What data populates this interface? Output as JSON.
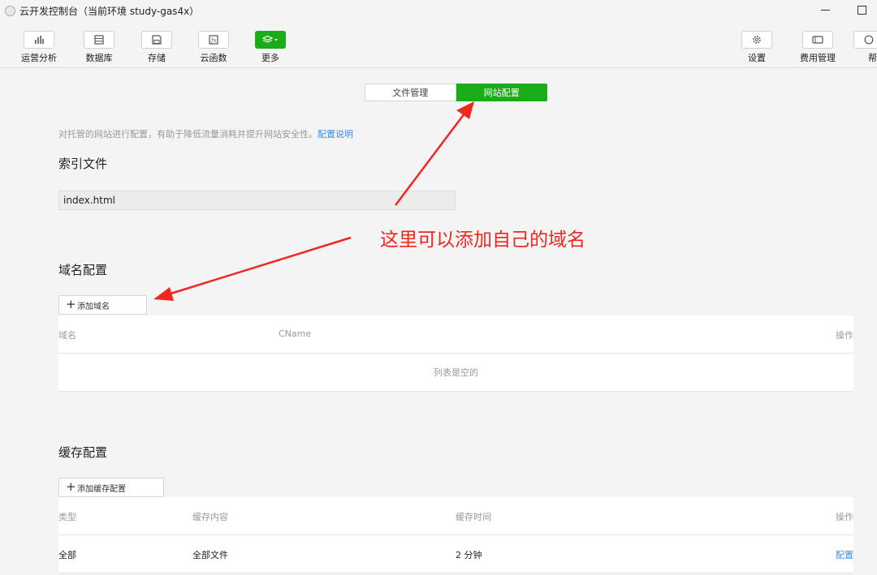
{
  "window": {
    "title": "云开发控制台（当前环境 study-gas4x）"
  },
  "toolbar": {
    "left_items": [
      {
        "label": "运营分析",
        "icon": "bar-chart-icon"
      },
      {
        "label": "数据库",
        "icon": "database-icon"
      },
      {
        "label": "存储",
        "icon": "storage-icon"
      },
      {
        "label": "云函数",
        "icon": "function-icon"
      },
      {
        "label": "更多",
        "icon": "layers-icon"
      }
    ],
    "right_items": [
      {
        "label": "设置",
        "icon": "gear-icon"
      },
      {
        "label": "费用管理",
        "icon": "billing-icon"
      },
      {
        "label": "帮",
        "icon": "help-icon"
      }
    ]
  },
  "tabs": {
    "file_manage": "文件管理",
    "site_config": "网站配置"
  },
  "description": {
    "text": "对托管的网站进行配置，有助于降低流量消耗并提升网站安全性。",
    "link": "配置说明"
  },
  "index_section": {
    "title": "索引文件",
    "value": "index.html"
  },
  "domain_section": {
    "title": "域名配置",
    "add_button": "添加域名",
    "columns": [
      "域名",
      "CName",
      "操作"
    ],
    "empty_text": "列表是空的"
  },
  "cache_section": {
    "title": "缓存配置",
    "add_button": "添加缓存配置",
    "columns": [
      "类型",
      "缓存内容",
      "缓存时间",
      "操作"
    ],
    "rows": [
      {
        "type": "全部",
        "content": "全部文件",
        "time": "2 分钟",
        "action": "配置"
      }
    ]
  },
  "annotation": {
    "text": "这里可以添加自己的域名",
    "color": "#f0261f"
  },
  "colors": {
    "accent": "#1aad19",
    "link": "#3a8ee6"
  }
}
